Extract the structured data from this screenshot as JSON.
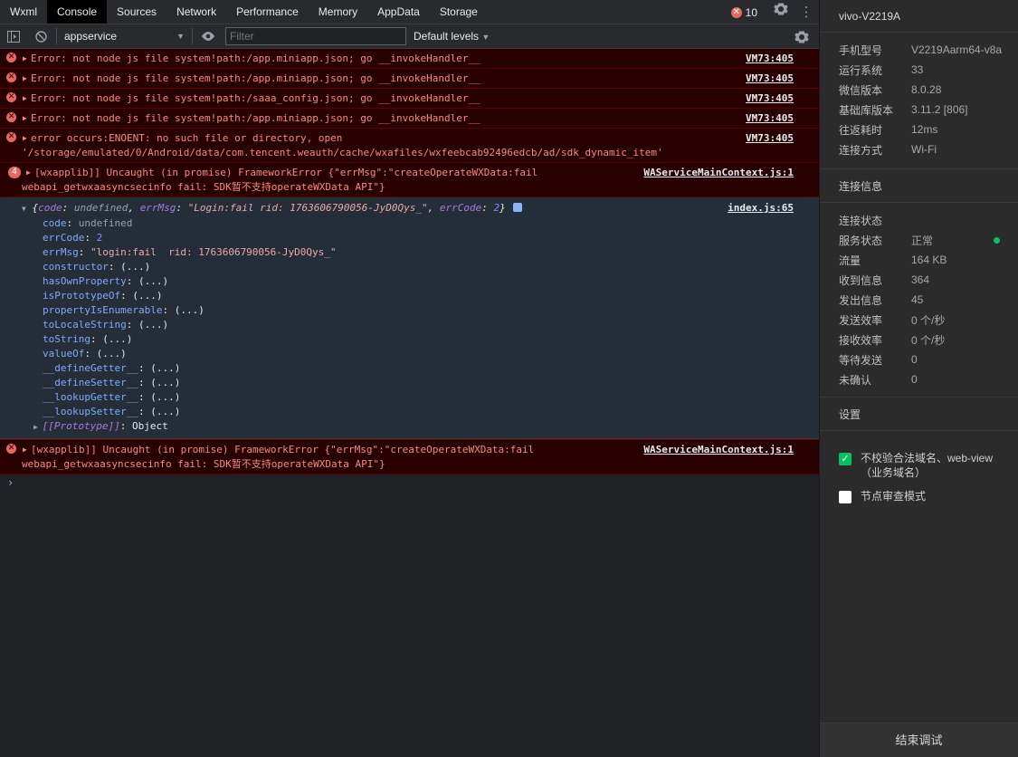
{
  "tabs": [
    "Wxml",
    "Console",
    "Sources",
    "Network",
    "Performance",
    "Memory",
    "AppData",
    "Storage"
  ],
  "active_tab": "Console",
  "error_count": "10",
  "toolbar": {
    "context": "appservice",
    "filter_placeholder": "Filter",
    "levels": "Default levels"
  },
  "console": {
    "errors": [
      {
        "text": "Error: not node js file system!path:/app.miniapp.json; go __invokeHandler__",
        "source": "VM73:405"
      },
      {
        "text": "Error: not node js file system!path:/app.miniapp.json; go __invokeHandler__",
        "source": "VM73:405"
      },
      {
        "text": "Error: not node js file system!path:/saaa_config.json; go __invokeHandler__",
        "source": "VM73:405"
      },
      {
        "text": "Error: not node js file system!path:/app.miniapp.json; go __invokeHandler__",
        "source": "VM73:405"
      }
    ],
    "enoent": {
      "line1": "error occurs:ENOENT: no such file or directory, open",
      "line2": "'/storage/emulated/0/Android/data/com.tencent.weauth/cache/wxafiles/wxfeebcab92496edcb/ad/sdk_dynamic_item'",
      "source": "VM73:405"
    },
    "framework1": {
      "count": "4",
      "line1": "[wxapplib]] Uncaught (in promise) FrameworkError {\"errMsg\":\"createOperateWXData:fail",
      "line2": "webapi_getwxaasyncsecinfo fail: SDK暂不支持operateWXData API\"}",
      "source": "WAServiceMainContext.js:1"
    },
    "object": {
      "source": "index.js:65",
      "head_code_key": "code",
      "head_code_val": "undefined",
      "head_msg_key": "errMsg",
      "head_msg_val": "\"Login:fail  rid: 1763606790056-JyD0Qys_\"",
      "head_errcode_key": "errCode",
      "head_errcode_val": "2",
      "code_key": "code",
      "code_val": "undefined",
      "errcode_key": "errCode",
      "errcode_val": "2",
      "errmsg_key": "errMsg",
      "errmsg_val": "\"login:fail  rid: 1763606790056-JyD0Qys_\"",
      "methods": [
        "constructor",
        "hasOwnProperty",
        "isPrototypeOf",
        "propertyIsEnumerable",
        "toLocaleString",
        "toString",
        "valueOf",
        "__defineGetter__",
        "__defineSetter__",
        "__lookupGetter__",
        "__lookupSetter__"
      ],
      "method_value": "(...)",
      "proto_key": "[[Prototype]]",
      "proto_val": "Object"
    },
    "framework2": {
      "line1": "[wxapplib]] Uncaught (in promise) FrameworkError {\"errMsg\":\"createOperateWXData:fail",
      "line2": "webapi_getwxaasyncsecinfo fail: SDK暂不支持operateWXData API\"}",
      "source": "WAServiceMainContext.js:1"
    },
    "prompt": "›"
  },
  "panel": {
    "device": "vivo-V2219A",
    "info": [
      {
        "key": "手机型号",
        "value": "V2219Aarm64-v8a"
      },
      {
        "key": "运行系统",
        "value": "33"
      },
      {
        "key": "微信版本",
        "value": "8.0.28"
      },
      {
        "key": "基础库版本",
        "value": "3.11.2 [806]"
      },
      {
        "key": "往返耗时",
        "value": "12ms"
      },
      {
        "key": "连接方式",
        "value": "Wi-Fi"
      }
    ],
    "conn_title": "连接信息",
    "conn": [
      {
        "key": "连接状态",
        "value": ""
      },
      {
        "key": "服务状态",
        "value": "正常"
      },
      {
        "key": "流量",
        "value": "164 KB"
      },
      {
        "key": "收到信息",
        "value": "364"
      },
      {
        "key": "发出信息",
        "value": "45"
      },
      {
        "key": "发送效率",
        "value": "0 个/秒"
      },
      {
        "key": "接收效率",
        "value": "0 个/秒"
      },
      {
        "key": "等待发送",
        "value": "0"
      },
      {
        "key": "未确认",
        "value": "0"
      }
    ],
    "settings_title": "设置",
    "check1": "不校验合法域名、web-view（业务域名）",
    "check2": "节点审查模式",
    "end_button": "结束调试",
    "status_color": "#07c160"
  }
}
